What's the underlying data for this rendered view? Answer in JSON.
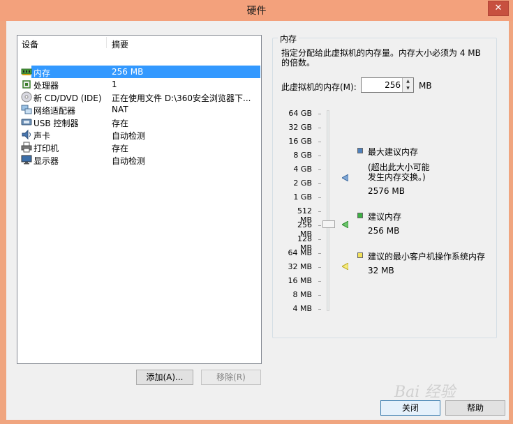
{
  "window": {
    "title": "硬件",
    "close_symbol": "✕"
  },
  "devices": {
    "header_device": "设备",
    "header_summary": "摘要",
    "rows": [
      {
        "name": "内存",
        "summary": "256 MB",
        "icon": "memory-icon",
        "selected": true
      },
      {
        "name": "处理器",
        "summary": "1",
        "icon": "processor-icon"
      },
      {
        "name": "新 CD/DVD (IDE)",
        "summary": "正在使用文件 D:\\360安全浏览器下...",
        "icon": "cd-dvd-icon"
      },
      {
        "name": "网络适配器",
        "summary": "NAT",
        "icon": "network-adapter-icon"
      },
      {
        "name": "USB 控制器",
        "summary": "存在",
        "icon": "usb-icon"
      },
      {
        "name": "声卡",
        "summary": "自动检测",
        "icon": "sound-card-icon"
      },
      {
        "name": "打印机",
        "summary": "存在",
        "icon": "printer-icon"
      },
      {
        "name": "显示器",
        "summary": "自动检测",
        "icon": "display-icon"
      }
    ]
  },
  "buttons": {
    "add": "添加(A)...",
    "remove": "移除(R)",
    "close": "关闭",
    "help": "帮助"
  },
  "memory": {
    "group_title": "内存",
    "description": "指定分配给此虚拟机的内存量。内存大小必须为 4 MB 的倍数。",
    "field_label": "此虚拟机的内存(M):",
    "value": "256",
    "unit": "MB",
    "scale_labels": [
      "64 GB",
      "32 GB",
      "16 GB",
      "8 GB",
      "4 GB",
      "2 GB",
      "1 GB",
      "512 MB",
      "256 MB",
      "128 MB",
      "64 MB",
      "32 MB",
      "16 MB",
      "8 MB",
      "4 MB"
    ],
    "slider_value_mb": 256,
    "max_recommended": {
      "title": "最大建议内存",
      "note_line1": "(超出此大小可能",
      "note_line2": "发生内存交换。)",
      "value": "2576 MB",
      "color": "#4f81bd"
    },
    "recommended": {
      "title": "建议内存",
      "value": "256 MB",
      "color": "#3cb043"
    },
    "min_recommended": {
      "title": "建议的最小客户机操作系统内存",
      "value": "32 MB",
      "color": "#f1e05a"
    }
  },
  "watermark": "Bai 经验"
}
